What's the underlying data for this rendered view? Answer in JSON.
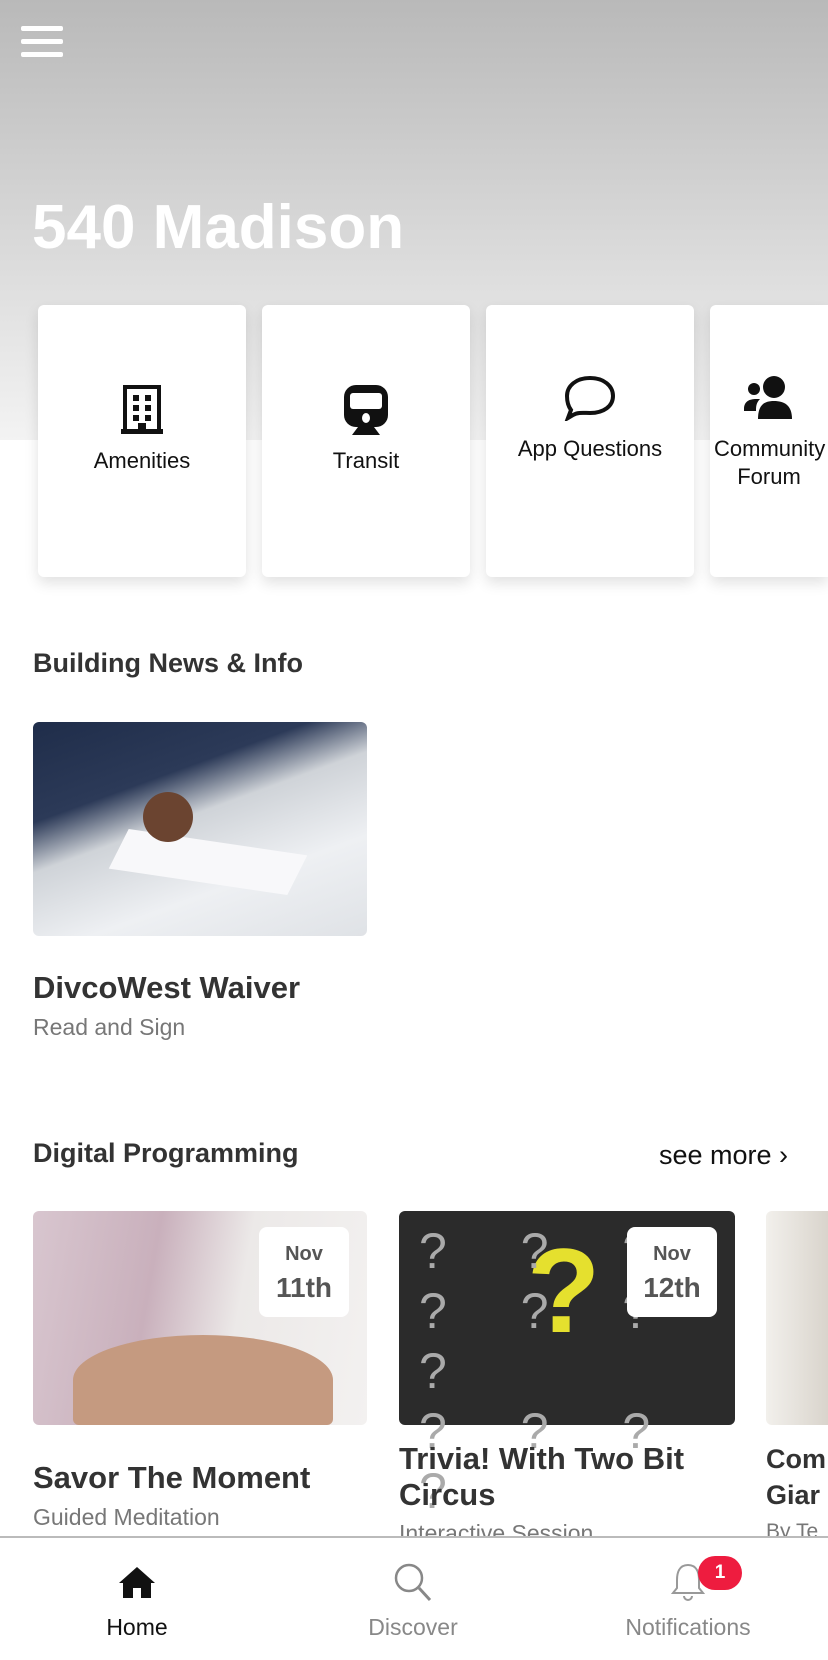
{
  "header": {
    "title": "540 Madison",
    "menu_icon": "hamburger-icon"
  },
  "quick_links": [
    {
      "label": "Amenities",
      "icon": "building-icon"
    },
    {
      "label": "Transit",
      "icon": "train-icon"
    },
    {
      "label": "App Questions",
      "icon": "chat-bubble-icon"
    },
    {
      "label": "Community Forum",
      "icon": "users-icon"
    }
  ],
  "news": {
    "heading": "Building News & Info",
    "items": [
      {
        "title": "DivcoWest Waiver",
        "subtitle": "Read and Sign"
      }
    ]
  },
  "programming": {
    "heading": "Digital Programming",
    "see_more": "see more ›",
    "events": [
      {
        "month": "Nov",
        "day": "11th",
        "title": "Savor The Moment",
        "subtitle": "Guided Meditation"
      },
      {
        "month": "Nov",
        "day": "12th",
        "title": "Trivia! With Two Bit Circus",
        "subtitle": "Interactive Session"
      },
      {
        "title": "Com Giar",
        "subtitle": "By Te"
      }
    ]
  },
  "tabbar": {
    "tabs": [
      {
        "label": "Home",
        "icon": "home-icon",
        "active": true
      },
      {
        "label": "Discover",
        "icon": "search-icon"
      },
      {
        "label": "Notifications",
        "icon": "bell-icon",
        "badge": "1"
      }
    ]
  },
  "colors": {
    "badge": "#ee1c3f",
    "text": "#333333"
  }
}
